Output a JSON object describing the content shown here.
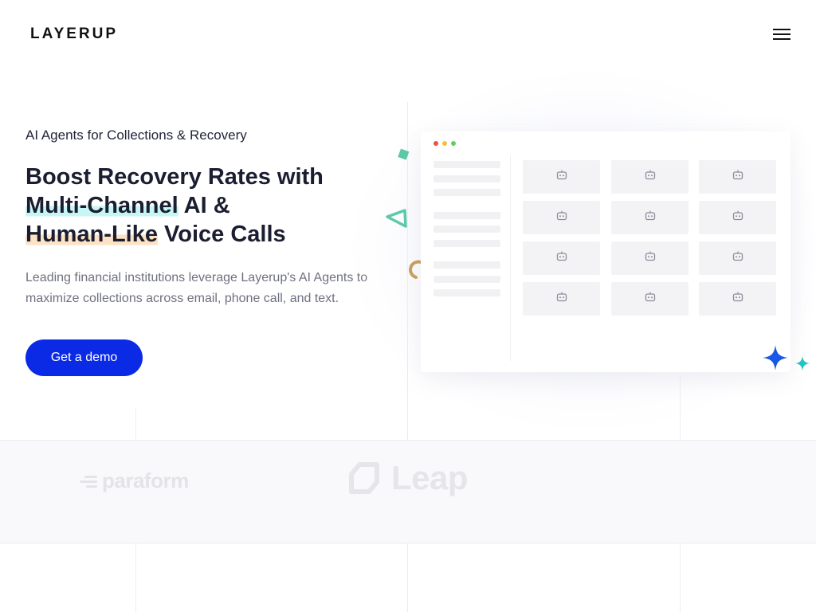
{
  "header": {
    "logo": "LAYERUP",
    "menu_icon": "hamburger-menu-icon"
  },
  "hero": {
    "eyebrow": "AI Agents for Collections & Recovery",
    "headline_line1": "Boost Recovery Rates with",
    "headline_hl1": "Multi-Channel",
    "headline_line2_rest": " AI &",
    "headline_hl2": "Human-Like",
    "headline_line3_rest": " Voice Calls",
    "subtext": "Leading financial institutions leverage Layerup's AI Agents to maximize collections across email, phone call, and text.",
    "cta_label": "Get a demo"
  },
  "mockup": {
    "window_dots": [
      "#e8553d",
      "#f2c23a",
      "#5fd05f"
    ],
    "tile_icon": "robot-icon",
    "tile_count": 12
  },
  "logos": {
    "paraform": "paraform",
    "leap": "Leap"
  },
  "colors": {
    "accent": "#0a2ae6",
    "highlight_cyan": "#c6f6f5",
    "highlight_peach": "#fde2c4",
    "sparkle_blue": "#1a56e8",
    "sparkle_teal": "#21c4c4",
    "shape_green": "#5cc9a7"
  }
}
